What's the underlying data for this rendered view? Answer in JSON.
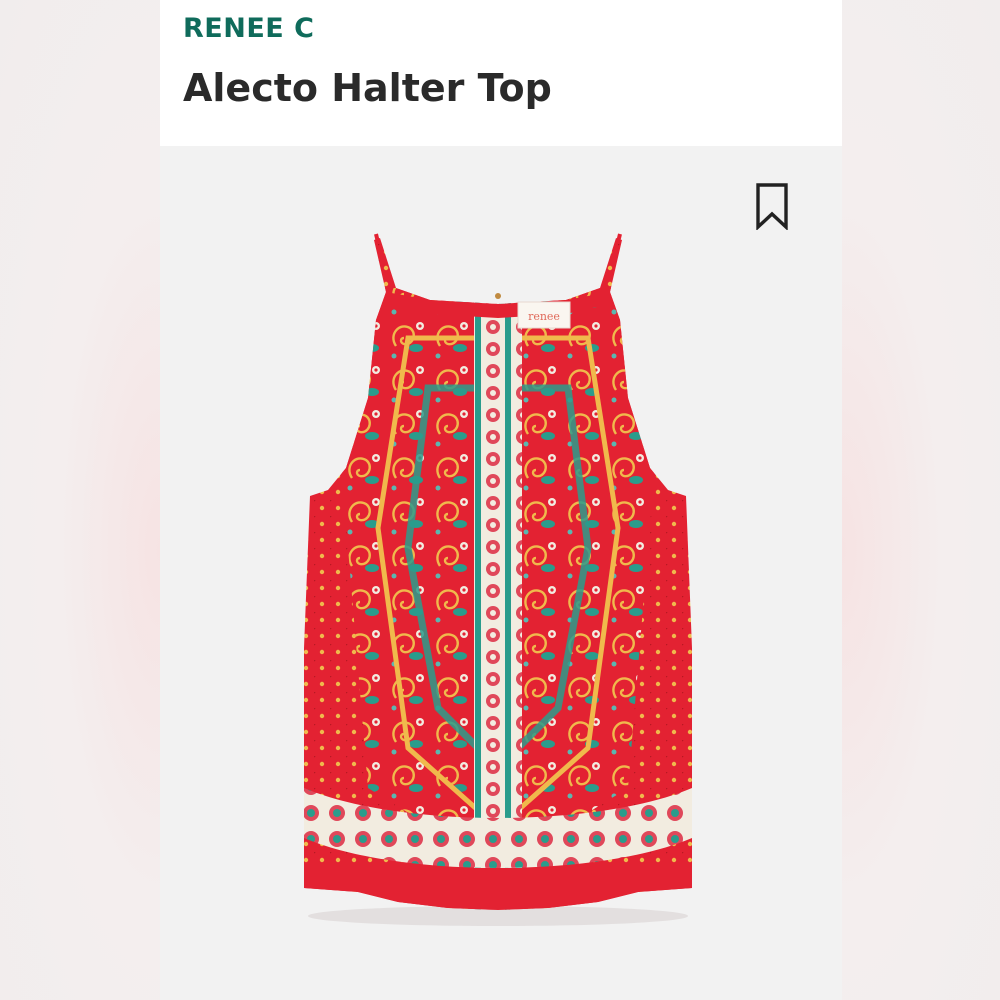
{
  "product": {
    "brand": "RENEE C",
    "title": "Alecto Halter Top"
  },
  "actions": {
    "bookmark_icon": "bookmark-icon"
  },
  "garment_tag": "renee",
  "colors": {
    "brand_accent": "#0f6b5b",
    "title_text": "#2a2a2a",
    "garment_red": "#e32232",
    "garment_teal": "#2a9c8c",
    "garment_gold": "#e9b64a",
    "garment_cream": "#f2ece0"
  }
}
